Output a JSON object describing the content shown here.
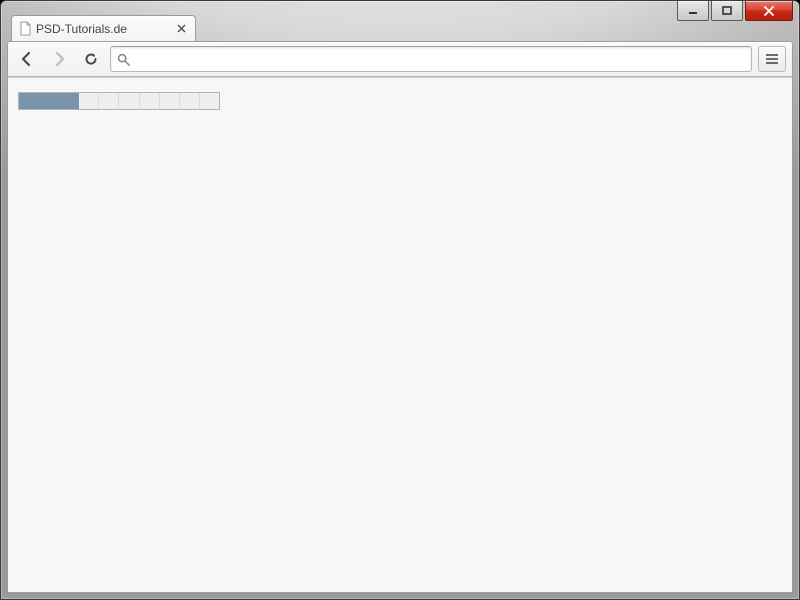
{
  "window": {
    "controls": {
      "minimize": "minimize",
      "maximize": "maximize",
      "close": "close"
    }
  },
  "tab": {
    "title": "PSD-Tutorials.de"
  },
  "toolbar": {
    "back_enabled": true,
    "forward_enabled": false,
    "address_value": ""
  },
  "page": {
    "meter": {
      "total_cells": 10,
      "filled_cells": 3,
      "fill_color": "#7a94ab"
    }
  }
}
